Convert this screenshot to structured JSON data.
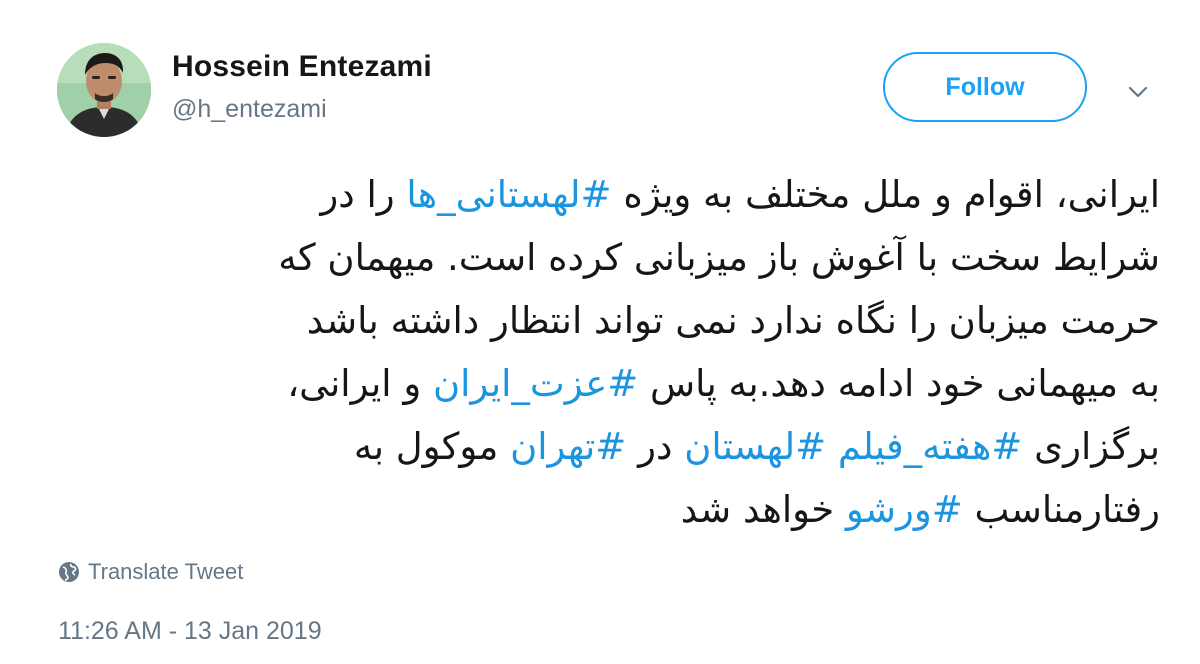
{
  "author": {
    "display_name": "Hossein Entezami",
    "handle": "@h_entezami"
  },
  "follow_button": {
    "label": "Follow"
  },
  "menu": {
    "icon": "chevron-down-icon"
  },
  "tweet": {
    "lines": [
      [
        {
          "t": "ایرانی، اقوام و ملل مختلف به ویژه "
        },
        {
          "t": "#لهستانی_ها",
          "tag": true
        },
        {
          "t": " را در"
        }
      ],
      [
        {
          "t": "شرایط سخت با آغوش باز میزبانی کرده است. میهمان که"
        }
      ],
      [
        {
          "t": "حرمت میزبان را نگاه ندارد نمی تواند انتظار داشته باشد"
        }
      ],
      [
        {
          "t": "به میهمانی خود ادامه دهد.به پاس "
        },
        {
          "t": "#عزت_ایران",
          "tag": true
        },
        {
          "t": " و ایرانی،"
        }
      ],
      [
        {
          "t": "برگزاری "
        },
        {
          "t": "#هفته_فیلم",
          "tag": true
        },
        {
          "t": " "
        },
        {
          "t": "#لهستان",
          "tag": true
        },
        {
          "t": " در "
        },
        {
          "t": "#تهران",
          "tag": true
        },
        {
          "t": " موکول به"
        }
      ],
      [
        {
          "t": "رفتارمناسب "
        },
        {
          "t": "#ورشو",
          "tag": true
        },
        {
          "t": " خواهد شد"
        }
      ]
    ]
  },
  "translate": {
    "label": "Translate Tweet",
    "icon": "globe-icon"
  },
  "timestamp": "11:26 AM - 13 Jan 2019",
  "colors": {
    "accent": "#1da1f2",
    "hashtag": "#1b95e0",
    "secondary_text": "#657786",
    "primary_text": "#14171a"
  }
}
